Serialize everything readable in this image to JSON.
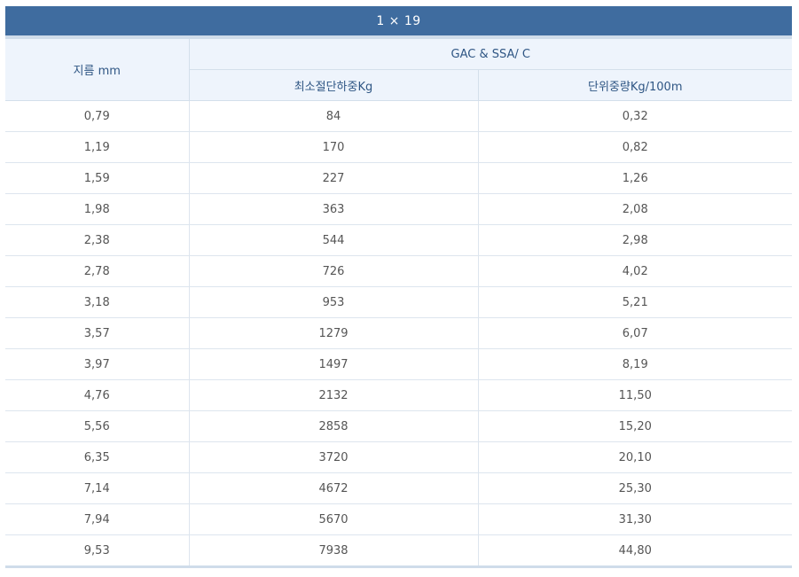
{
  "title": "1 × 19",
  "headers": {
    "diameter": "지름 mm",
    "group": "GAC & SSA/ C",
    "breaking_load": "최소절단하중Kg",
    "unit_weight": "단위중량Kg/100m"
  },
  "rows": [
    {
      "d": "0,79",
      "load": "84",
      "weight": "0,32"
    },
    {
      "d": "1,19",
      "load": "170",
      "weight": "0,82"
    },
    {
      "d": "1,59",
      "load": "227",
      "weight": "1,26"
    },
    {
      "d": "1,98",
      "load": "363",
      "weight": "2,08"
    },
    {
      "d": "2,38",
      "load": "544",
      "weight": "2,98"
    },
    {
      "d": "2,78",
      "load": "726",
      "weight": "4,02"
    },
    {
      "d": "3,18",
      "load": "953",
      "weight": "5,21"
    },
    {
      "d": "3,57",
      "load": "1279",
      "weight": "6,07"
    },
    {
      "d": "3,97",
      "load": "1497",
      "weight": "8,19"
    },
    {
      "d": "4,76",
      "load": "2132",
      "weight": "11,50"
    },
    {
      "d": "5,56",
      "load": "2858",
      "weight": "15,20"
    },
    {
      "d": "6,35",
      "load": "3720",
      "weight": "20,10"
    },
    {
      "d": "7,14",
      "load": "4672",
      "weight": "25,30"
    },
    {
      "d": "7,94",
      "load": "5670",
      "weight": "31,30"
    },
    {
      "d": "9,53",
      "load": "7938",
      "weight": "44,80"
    }
  ],
  "colors": {
    "title_bg": "#3f6c9f",
    "header_bg": "#eef4fc",
    "header_text": "#2f5684"
  }
}
